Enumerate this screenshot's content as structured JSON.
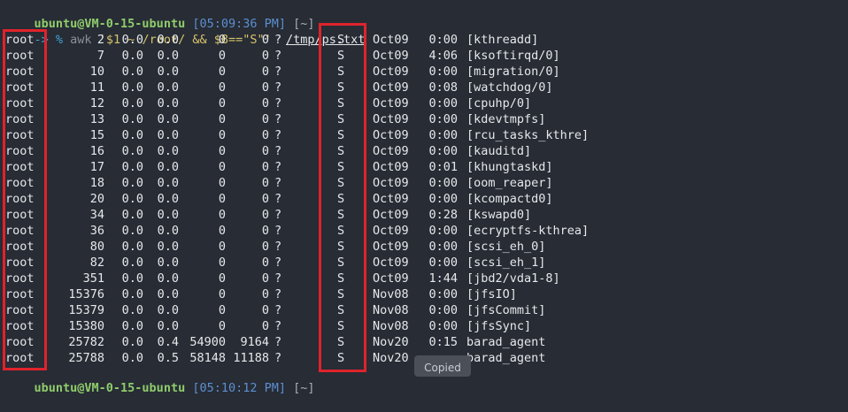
{
  "prompt": {
    "user_host": "ubuntu@VM-0-15-ubuntu",
    "time": "[05:09:36 PM]",
    "dir": "[~]",
    "arrow": "-> %",
    "cmd_prefix": "awk ",
    "cmd_expr": "'$1 ~ /root/ && $8==\"S\"'",
    "cmd_file": "/tmp/ps.txt"
  },
  "rows": [
    {
      "user": "root",
      "pid": "2",
      "cpu": "0.0",
      "mem": "0.0",
      "vsz": "0",
      "rss": "0",
      "tty": "?",
      "stat": "S",
      "start": "Oct09",
      "time": "0:00",
      "command": "[kthreadd]"
    },
    {
      "user": "root",
      "pid": "7",
      "cpu": "0.0",
      "mem": "0.0",
      "vsz": "0",
      "rss": "0",
      "tty": "?",
      "stat": "S",
      "start": "Oct09",
      "time": "4:06",
      "command": "[ksoftirqd/0]"
    },
    {
      "user": "root",
      "pid": "10",
      "cpu": "0.0",
      "mem": "0.0",
      "vsz": "0",
      "rss": "0",
      "tty": "?",
      "stat": "S",
      "start": "Oct09",
      "time": "0:00",
      "command": "[migration/0]"
    },
    {
      "user": "root",
      "pid": "11",
      "cpu": "0.0",
      "mem": "0.0",
      "vsz": "0",
      "rss": "0",
      "tty": "?",
      "stat": "S",
      "start": "Oct09",
      "time": "0:08",
      "command": "[watchdog/0]"
    },
    {
      "user": "root",
      "pid": "12",
      "cpu": "0.0",
      "mem": "0.0",
      "vsz": "0",
      "rss": "0",
      "tty": "?",
      "stat": "S",
      "start": "Oct09",
      "time": "0:00",
      "command": "[cpuhp/0]"
    },
    {
      "user": "root",
      "pid": "13",
      "cpu": "0.0",
      "mem": "0.0",
      "vsz": "0",
      "rss": "0",
      "tty": "?",
      "stat": "S",
      "start": "Oct09",
      "time": "0:00",
      "command": "[kdevtmpfs]"
    },
    {
      "user": "root",
      "pid": "15",
      "cpu": "0.0",
      "mem": "0.0",
      "vsz": "0",
      "rss": "0",
      "tty": "?",
      "stat": "S",
      "start": "Oct09",
      "time": "0:00",
      "command": "[rcu_tasks_kthre]"
    },
    {
      "user": "root",
      "pid": "16",
      "cpu": "0.0",
      "mem": "0.0",
      "vsz": "0",
      "rss": "0",
      "tty": "?",
      "stat": "S",
      "start": "Oct09",
      "time": "0:00",
      "command": "[kauditd]"
    },
    {
      "user": "root",
      "pid": "17",
      "cpu": "0.0",
      "mem": "0.0",
      "vsz": "0",
      "rss": "0",
      "tty": "?",
      "stat": "S",
      "start": "Oct09",
      "time": "0:01",
      "command": "[khungtaskd]"
    },
    {
      "user": "root",
      "pid": "18",
      "cpu": "0.0",
      "mem": "0.0",
      "vsz": "0",
      "rss": "0",
      "tty": "?",
      "stat": "S",
      "start": "Oct09",
      "time": "0:00",
      "command": "[oom_reaper]"
    },
    {
      "user": "root",
      "pid": "20",
      "cpu": "0.0",
      "mem": "0.0",
      "vsz": "0",
      "rss": "0",
      "tty": "?",
      "stat": "S",
      "start": "Oct09",
      "time": "0:00",
      "command": "[kcompactd0]"
    },
    {
      "user": "root",
      "pid": "34",
      "cpu": "0.0",
      "mem": "0.0",
      "vsz": "0",
      "rss": "0",
      "tty": "?",
      "stat": "S",
      "start": "Oct09",
      "time": "0:28",
      "command": "[kswapd0]"
    },
    {
      "user": "root",
      "pid": "36",
      "cpu": "0.0",
      "mem": "0.0",
      "vsz": "0",
      "rss": "0",
      "tty": "?",
      "stat": "S",
      "start": "Oct09",
      "time": "0:00",
      "command": "[ecryptfs-kthrea]"
    },
    {
      "user": "root",
      "pid": "80",
      "cpu": "0.0",
      "mem": "0.0",
      "vsz": "0",
      "rss": "0",
      "tty": "?",
      "stat": "S",
      "start": "Oct09",
      "time": "0:00",
      "command": "[scsi_eh_0]"
    },
    {
      "user": "root",
      "pid": "82",
      "cpu": "0.0",
      "mem": "0.0",
      "vsz": "0",
      "rss": "0",
      "tty": "?",
      "stat": "S",
      "start": "Oct09",
      "time": "0:00",
      "command": "[scsi_eh_1]"
    },
    {
      "user": "root",
      "pid": "351",
      "cpu": "0.0",
      "mem": "0.0",
      "vsz": "0",
      "rss": "0",
      "tty": "?",
      "stat": "S",
      "start": "Oct09",
      "time": "1:44",
      "command": "[jbd2/vda1-8]"
    },
    {
      "user": "root",
      "pid": "15376",
      "cpu": "0.0",
      "mem": "0.0",
      "vsz": "0",
      "rss": "0",
      "tty": "?",
      "stat": "S",
      "start": "Nov08",
      "time": "0:00",
      "command": "[jfsIO]"
    },
    {
      "user": "root",
      "pid": "15379",
      "cpu": "0.0",
      "mem": "0.0",
      "vsz": "0",
      "rss": "0",
      "tty": "?",
      "stat": "S",
      "start": "Nov08",
      "time": "0:00",
      "command": "[jfsCommit]"
    },
    {
      "user": "root",
      "pid": "15380",
      "cpu": "0.0",
      "mem": "0.0",
      "vsz": "0",
      "rss": "0",
      "tty": "?",
      "stat": "S",
      "start": "Nov08",
      "time": "0:00",
      "command": "[jfsSync]"
    },
    {
      "user": "root",
      "pid": "25782",
      "cpu": "0.0",
      "mem": "0.4",
      "vsz": "54900",
      "rss": "9164",
      "tty": "?",
      "stat": "S",
      "start": "Nov20",
      "time": "0:15",
      "command": "barad_agent"
    },
    {
      "user": "root",
      "pid": "25788",
      "cpu": "0.0",
      "mem": "0.5",
      "vsz": "58148",
      "rss": "11188",
      "tty": "?",
      "stat": "S",
      "start": "Nov20",
      "time": "",
      "command": "barad_agent"
    }
  ],
  "next_prompt": {
    "user_host": "ubuntu@VM-0-15-ubuntu",
    "time": "[05:10:12 PM]",
    "dir": "[~]"
  },
  "tooltip": "Copied",
  "colors": {
    "background": "#272c35",
    "highlight_box": "#e0232b",
    "prompt_user": "#8fcc6b",
    "prompt_time": "#5d8fd0"
  }
}
